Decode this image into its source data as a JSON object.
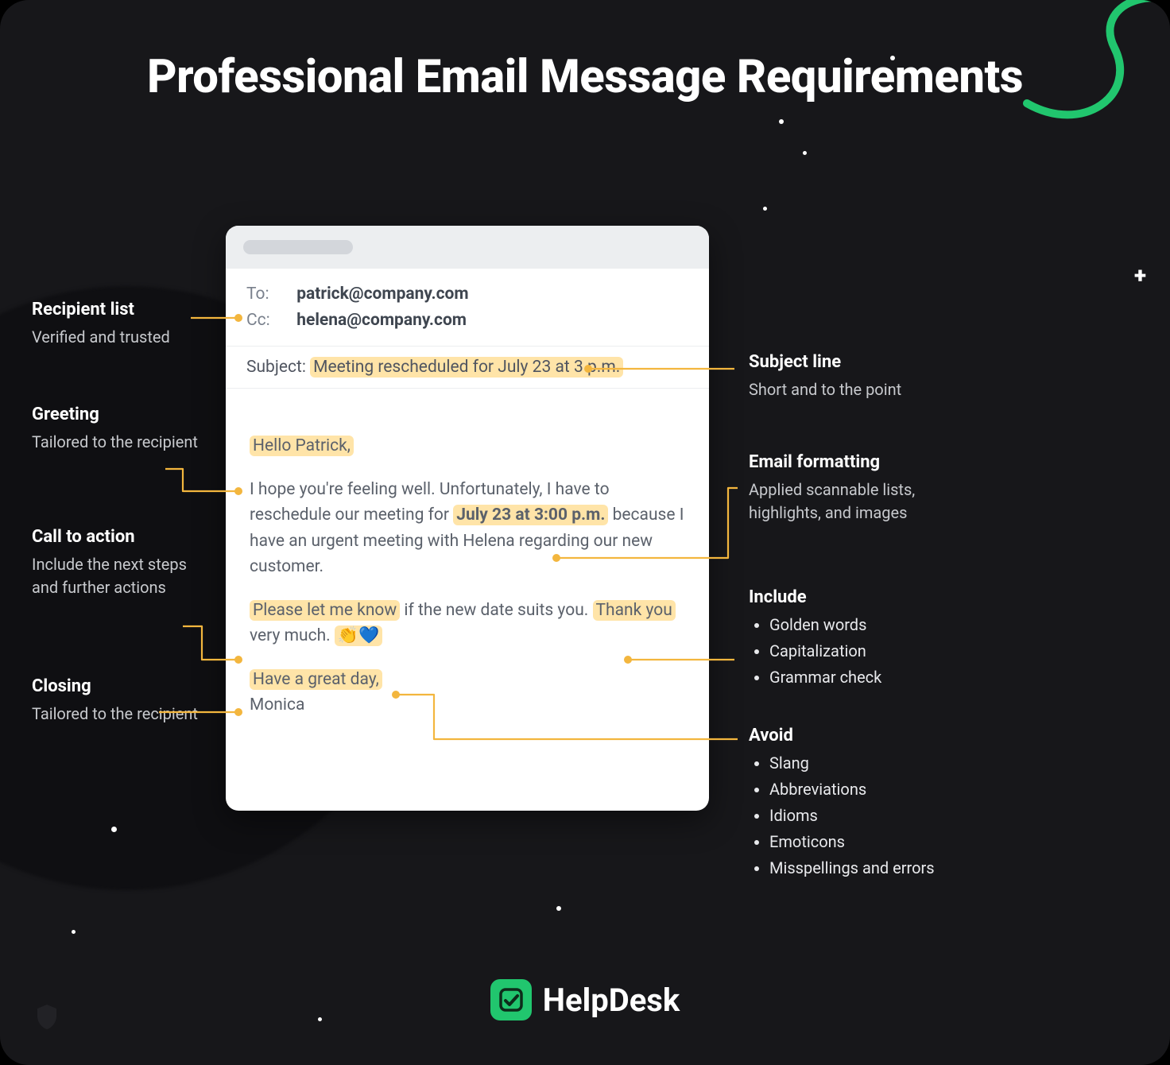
{
  "title": "Professional Email Message Requirements",
  "email": {
    "to_label": "To:",
    "to_value": "patrick@company.com",
    "cc_label": "Cc:",
    "cc_value": "helena@company.com",
    "subject_label": "Subject:",
    "subject_value": "Meeting rescheduled for July 23 at 3 p.m.",
    "greeting": "Hello Patrick,",
    "body_pre": "I hope you're feeling well. Unfortunately, I have to reschedule our meeting for ",
    "body_bold": "July 23 at 3:00 p.m.",
    "body_post": " because I have an urgent meeting with Helena regarding our new customer.",
    "cta_hl": "Please let me know",
    "cta_mid": " if the new date suits you. ",
    "cta_thanks": "Thank you",
    "cta_end": " very much. ",
    "emojis": "👏💙",
    "closing": "Have a great day,",
    "signature": "Monica"
  },
  "left": [
    {
      "title": "Recipient list",
      "desc": "Verified and trusted"
    },
    {
      "title": "Greeting",
      "desc": "Tailored to the recipient"
    },
    {
      "title": "Call to action",
      "desc": "Include the next steps and further actions"
    },
    {
      "title": "Closing",
      "desc": "Tailored to the recipient"
    }
  ],
  "right": [
    {
      "title": "Subject line",
      "desc": "Short and to the point"
    },
    {
      "title": "Email formatting",
      "desc": "Applied scannable lists, highlights, and images"
    }
  ],
  "include": {
    "title": "Include",
    "items": [
      "Golden words",
      "Capitalization",
      "Grammar check"
    ]
  },
  "avoid": {
    "title": "Avoid",
    "items": [
      "Slang",
      "Abbreviations",
      "Idioms",
      "Emoticons",
      "Misspellings and errors"
    ]
  },
  "brand": "HelpDesk"
}
